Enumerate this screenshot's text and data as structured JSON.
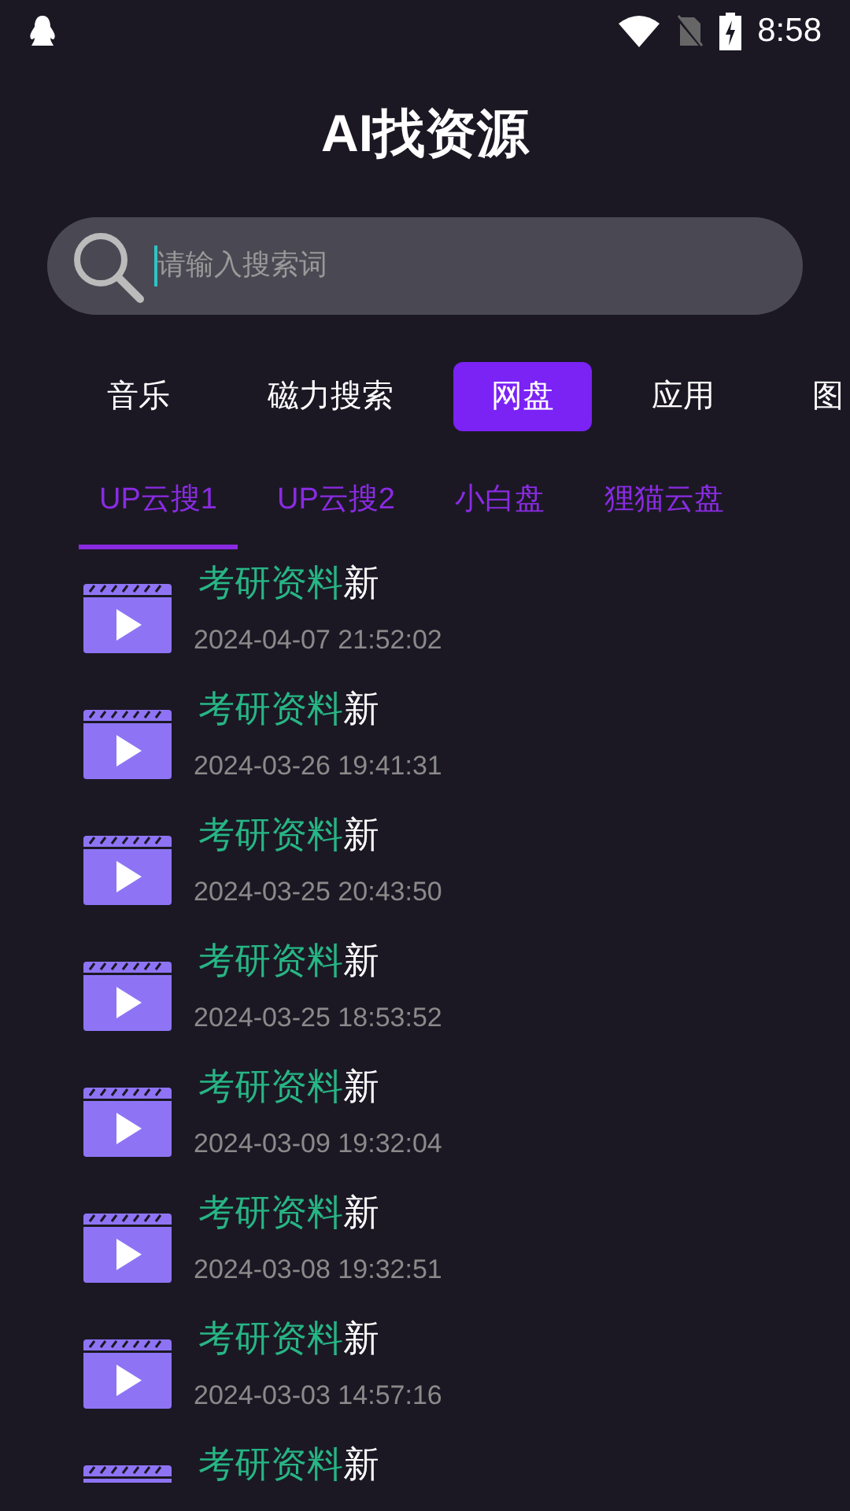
{
  "status_bar": {
    "time": "8:58"
  },
  "title": "AI找资源",
  "search": {
    "placeholder": "请输入搜索词"
  },
  "categories": [
    {
      "label": "音乐",
      "selected": false
    },
    {
      "label": "磁力搜索",
      "selected": false
    },
    {
      "label": "网盘",
      "selected": true
    },
    {
      "label": "应用",
      "selected": false
    },
    {
      "label": "图",
      "selected": false
    }
  ],
  "sources": [
    {
      "label": "UP云搜1",
      "selected": true
    },
    {
      "label": "UP云搜2",
      "selected": false
    },
    {
      "label": "小白盘",
      "selected": false
    },
    {
      "label": "狸猫云盘",
      "selected": false
    }
  ],
  "results": [
    {
      "keyword": "考研资料",
      "rest": "新",
      "date": "2024-04-07 21:52:02"
    },
    {
      "keyword": "考研资料",
      "rest": "新",
      "date": "2024-03-26 19:41:31"
    },
    {
      "keyword": "考研资料",
      "rest": "新",
      "date": "2024-03-25 20:43:50"
    },
    {
      "keyword": "考研资料",
      "rest": "新",
      "date": "2024-03-25 18:53:52"
    },
    {
      "keyword": "考研资料",
      "rest": "新",
      "date": "2024-03-09 19:32:04"
    },
    {
      "keyword": "考研资料",
      "rest": "新",
      "date": "2024-03-08 19:32:51"
    },
    {
      "keyword": "考研资料",
      "rest": "新",
      "date": "2024-03-03 14:57:16"
    },
    {
      "keyword": "考研资料",
      "rest": "新"
    }
  ]
}
